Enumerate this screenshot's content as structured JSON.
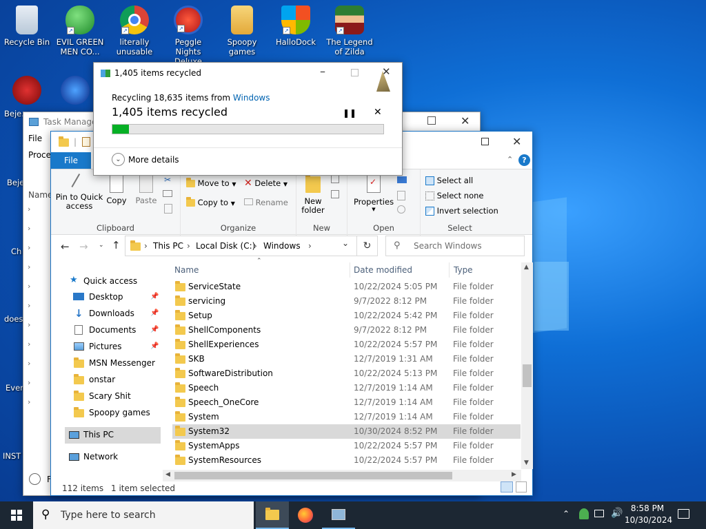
{
  "desktop": {
    "icons": [
      {
        "label": "Recycle Bin"
      },
      {
        "label": "EVIL GREEN MEN CO..."
      },
      {
        "label": "literally unusable"
      },
      {
        "label": "Peggle Nights Deluxe"
      },
      {
        "label": "Spoopy games"
      },
      {
        "label": "HalloDock"
      },
      {
        "label": "The Legend of Zilda"
      }
    ],
    "left_icons": [
      "Beje… De",
      "Beje De",
      "Ch De",
      "does",
      "Ever",
      "INST"
    ]
  },
  "recycle_dialog": {
    "title": "1,405 items recycled",
    "from_prefix": "Recycling 18,635 items from ",
    "from_link": "Windows",
    "status": "1,405 items recycled",
    "progress": 0.06,
    "more_details": "More details"
  },
  "task_manager": {
    "title": "Task Manager",
    "menu_file": "File",
    "tab": "Proces",
    "col_name": "Name",
    "footer": "F"
  },
  "explorer": {
    "ribbon_tabs": {
      "file": "File"
    },
    "clipboard": {
      "pin": "Pin to Quick access",
      "copy": "Copy",
      "paste": "Paste",
      "label": "Clipboard"
    },
    "organize": {
      "move_to": "Move to",
      "copy_to": "Copy to",
      "delete": "Delete",
      "rename": "Rename",
      "label": "Organize"
    },
    "new": {
      "new_folder": "New folder",
      "label": "New"
    },
    "open": {
      "properties": "Properties",
      "label": "Open"
    },
    "select": {
      "select_all": "Select all",
      "select_none": "Select none",
      "invert": "Invert selection",
      "label": "Select"
    },
    "breadcrumb": [
      "This PC",
      "Local Disk (C:)",
      "Windows"
    ],
    "search_placeholder": "Search Windows",
    "columns": {
      "name": "Name",
      "date": "Date modified",
      "type": "Type"
    },
    "nav": {
      "quick_access": "Quick access",
      "items": [
        "Desktop",
        "Downloads",
        "Documents",
        "Pictures",
        "MSN Messenger",
        "onstar",
        "Scary Shit",
        "Spoopy games"
      ],
      "this_pc": "This PC",
      "network": "Network"
    },
    "files": [
      {
        "name": "ServiceState",
        "date": "10/22/2024 5:05 PM",
        "type": "File folder"
      },
      {
        "name": "servicing",
        "date": "9/7/2022 8:12 PM",
        "type": "File folder"
      },
      {
        "name": "Setup",
        "date": "10/22/2024 5:42 PM",
        "type": "File folder"
      },
      {
        "name": "ShellComponents",
        "date": "9/7/2022 8:12 PM",
        "type": "File folder"
      },
      {
        "name": "ShellExperiences",
        "date": "10/22/2024 5:57 PM",
        "type": "File folder"
      },
      {
        "name": "SKB",
        "date": "12/7/2019 1:31 AM",
        "type": "File folder"
      },
      {
        "name": "SoftwareDistribution",
        "date": "10/22/2024 5:13 PM",
        "type": "File folder"
      },
      {
        "name": "Speech",
        "date": "12/7/2019 1:14 AM",
        "type": "File folder"
      },
      {
        "name": "Speech_OneCore",
        "date": "12/7/2019 1:14 AM",
        "type": "File folder"
      },
      {
        "name": "System",
        "date": "12/7/2019 1:14 AM",
        "type": "File folder"
      },
      {
        "name": "System32",
        "date": "10/30/2024 8:52 PM",
        "type": "File folder"
      },
      {
        "name": "SystemApps",
        "date": "10/22/2024 5:57 PM",
        "type": "File folder"
      },
      {
        "name": "SystemResources",
        "date": "10/22/2024 5:57 PM",
        "type": "File folder"
      }
    ],
    "status": {
      "count": "112 items",
      "selected": "1 item selected"
    }
  },
  "taskbar": {
    "search_placeholder": "Type here to search",
    "time": "8:58 PM",
    "date": "10/30/2024"
  },
  "colors": {
    "accent": "#0063b1",
    "selected_row": "#d9d9d9",
    "progress": "#06b025"
  }
}
